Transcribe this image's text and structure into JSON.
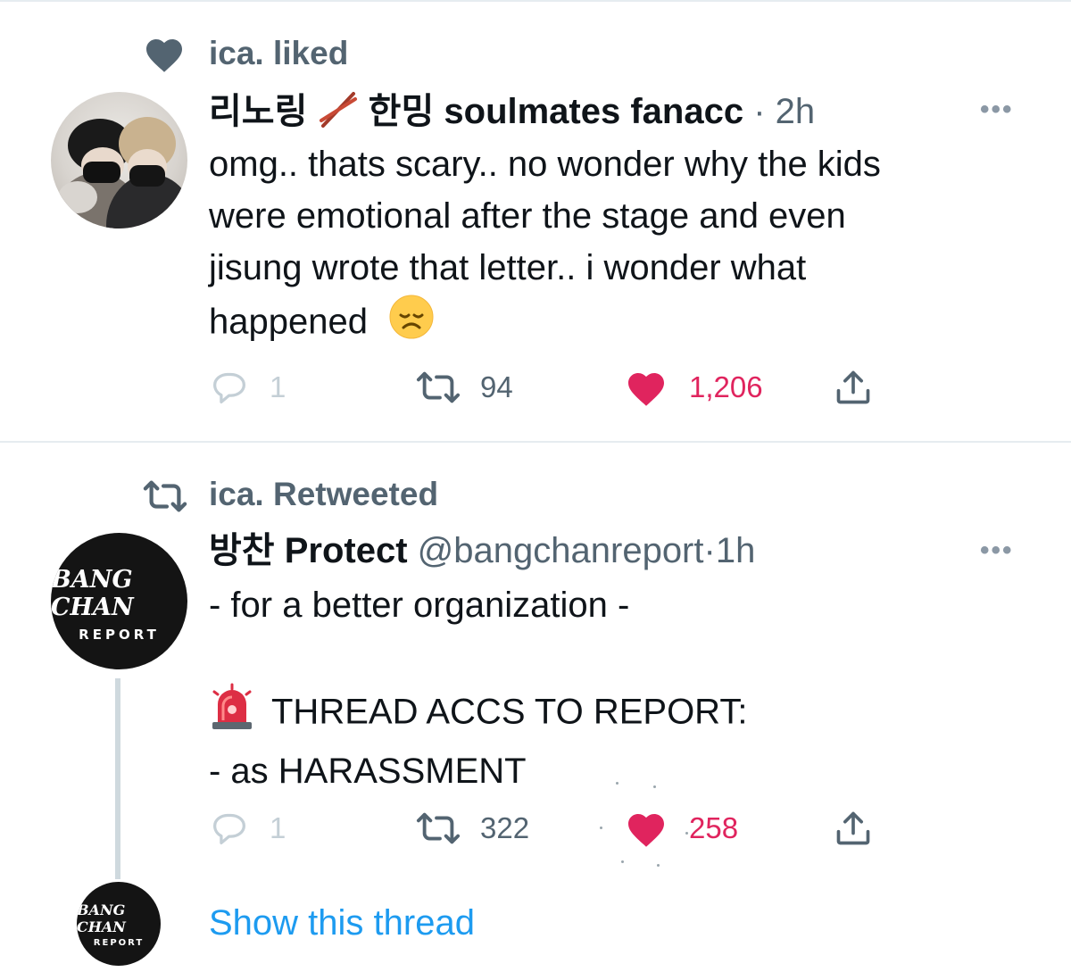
{
  "tweet1": {
    "context_text": "ica. liked",
    "context_icon": "heart-icon",
    "name_ko1": "리노링",
    "chopsticks_icon": "chopsticks-emoji",
    "name_ko2": "한밍",
    "name_en": "soulmates fanacc",
    "separator": "·",
    "time": "2h",
    "more_label": "•••",
    "body_lines": [
      "omg.. thats scary.. no wonder why the kids",
      "were emotional after the stage and even",
      "jisung wrote that letter.. i wonder what",
      "happened"
    ],
    "body_emoji": "disappointed-face-emoji",
    "reply_count": "1",
    "retweet_count": "94",
    "like_count": "1,206",
    "liked": true
  },
  "tweet2": {
    "context_text": "ica. Retweeted",
    "context_icon": "retweet-icon",
    "name_ko": "방찬",
    "name_en": "Protect",
    "handle": "@bangchanreport",
    "separator": "·",
    "time": "1h",
    "more_label": "•••",
    "avatar_logo_main": "BANG CHAN",
    "avatar_logo_sub": "REPORT",
    "line1": "- for a better organization -",
    "siren_icon": "police-light-emoji",
    "line2": "THREAD ACCS TO REPORT:",
    "line3": "- as HARASSMENT",
    "reply_count": "1",
    "retweet_count": "322",
    "like_count": "258",
    "liked": true
  },
  "thread": {
    "avatar_logo_main": "BANG CHAN",
    "avatar_logo_sub": "REPORT",
    "show_thread_label": "Show this thread"
  },
  "colors": {
    "like_pink": "#e0245e",
    "link_blue": "#1d9bf0",
    "secondary_gray": "#536471",
    "divider": "#e6ecf0"
  }
}
